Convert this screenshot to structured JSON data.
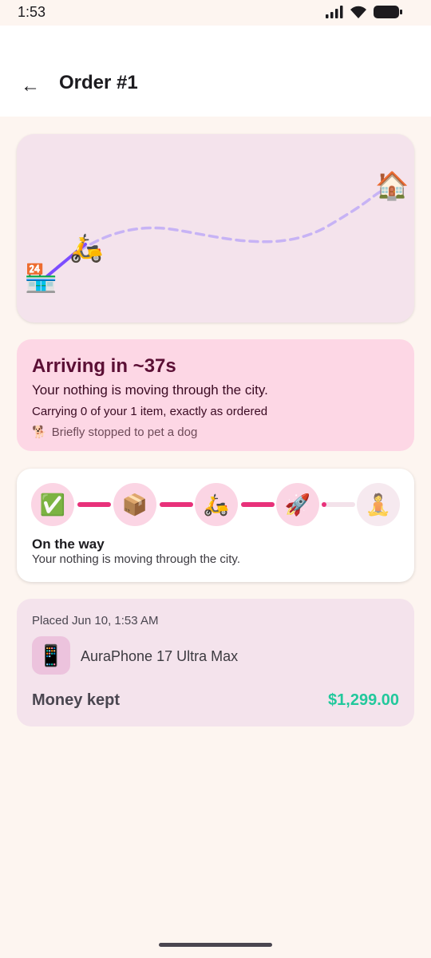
{
  "status_bar": {
    "time": "1:53"
  },
  "header": {
    "back_icon": "arrow-back-icon",
    "title": "Order #1"
  },
  "map": {
    "store_emoji": "🏪",
    "scooter_emoji": "🛵",
    "home_emoji": "🏠",
    "progress": 0.15,
    "route_done_color": "#7c4dff",
    "route_remaining_color": "#c7b3f5"
  },
  "eta": {
    "title": "Arriving in ~37s",
    "subtitle": "Your nothing is moving through the city.",
    "carrying": "Carrying 0 of your 1 item, exactly as ordered",
    "status_emoji": "🐕",
    "status_text": "Briefly stopped to pet a dog"
  },
  "steps": {
    "icons": [
      "✅",
      "📦",
      "🛵",
      "🚀",
      "🧘"
    ],
    "connector_progress": [
      1,
      1,
      1,
      0.15
    ],
    "current_title": "On the way",
    "current_subtitle": "Your nothing is moving through the city.",
    "accent": "#e8317a"
  },
  "order": {
    "placed": "Placed Jun 10, 1:53 AM",
    "item_emoji": "📱",
    "item_name": "AuraPhone 17 Ultra Max",
    "money_label": "Money kept",
    "money_value": "$1,299.00"
  }
}
